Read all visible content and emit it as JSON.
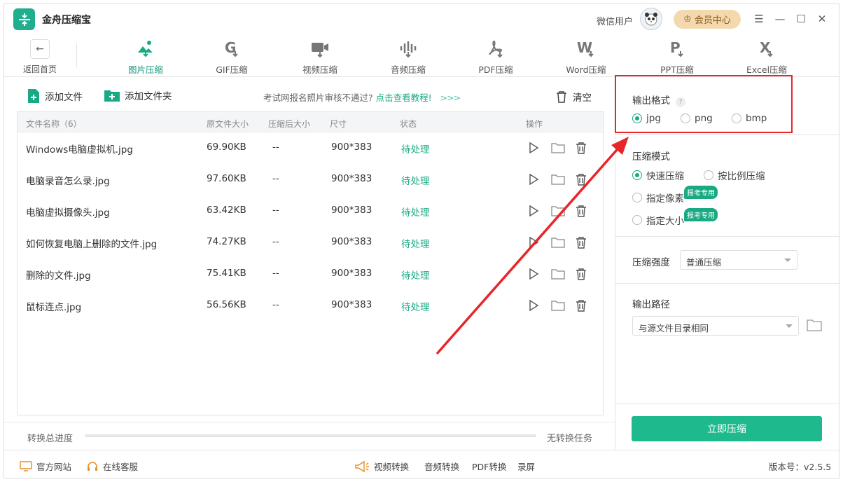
{
  "app": {
    "title": "金舟压缩宝"
  },
  "titlebar": {
    "user": "微信用户",
    "vip_label": "会员中心"
  },
  "nav": {
    "back_label": "返回首页",
    "tools": [
      {
        "label": "图片压缩",
        "icon": "image-compress-icon",
        "active": true
      },
      {
        "label": "GIF压缩",
        "icon": "gif-icon"
      },
      {
        "label": "视频压缩",
        "icon": "video-icon"
      },
      {
        "label": "音频压缩",
        "icon": "audio-icon"
      },
      {
        "label": "PDF压缩",
        "icon": "pdf-icon"
      },
      {
        "label": "Word压缩",
        "icon": "word-icon"
      },
      {
        "label": "PPT压缩",
        "icon": "ppt-icon"
      },
      {
        "label": "Excel压缩",
        "icon": "excel-icon"
      }
    ]
  },
  "actions": {
    "add_file": "添加文件",
    "add_folder": "添加文件夹",
    "hint_text": "考试网报名照片审核不通过?",
    "hint_link": "点击查看教程!",
    "hint_arrows": ">>>",
    "clear": "清空"
  },
  "table": {
    "headers": {
      "name": "文件名称（6）",
      "orig": "原文件大小",
      "comp": "压缩后大小",
      "size": "尺寸",
      "status": "状态",
      "ops": "操作"
    },
    "rows": [
      {
        "name": "Windows电脑虚拟机.jpg",
        "orig": "69.90KB",
        "comp": "--",
        "size": "900*383",
        "status": "待处理"
      },
      {
        "name": "电脑录音怎么录.jpg",
        "orig": "97.60KB",
        "comp": "--",
        "size": "900*383",
        "status": "待处理"
      },
      {
        "name": "电脑虚拟摄像头.jpg",
        "orig": "63.42KB",
        "comp": "--",
        "size": "900*383",
        "status": "待处理"
      },
      {
        "name": "如何恢复电脑上删除的文件.jpg",
        "orig": "74.27KB",
        "comp": "--",
        "size": "900*383",
        "status": "待处理"
      },
      {
        "name": "删除的文件.jpg",
        "orig": "75.41KB",
        "comp": "--",
        "size": "900*383",
        "status": "待处理"
      },
      {
        "name": "鼠标连点.jpg",
        "orig": "56.56KB",
        "comp": "--",
        "size": "900*383",
        "status": "待处理"
      }
    ]
  },
  "progress": {
    "label": "转换总进度",
    "status": "无转换任务",
    "value": 0
  },
  "settings": {
    "format": {
      "title": "输出格式",
      "help": "?",
      "options": [
        "jpg",
        "png",
        "bmp"
      ],
      "selected": "jpg"
    },
    "mode": {
      "title": "压缩模式",
      "fast": "快速压缩",
      "ratio": "按比例压缩",
      "pixel": "指定像素",
      "size": "指定大小",
      "badge": "报考专用",
      "selected": "快速压缩"
    },
    "strength": {
      "title": "压缩强度",
      "value": "普通压缩"
    },
    "path": {
      "title": "输出路径",
      "value": "与源文件目录相同"
    },
    "go": "立即压缩"
  },
  "footer": {
    "website": "官方网站",
    "support": "在线客服",
    "video_convert": "视频转换",
    "audio_convert": "音频转换",
    "pdf_convert": "PDF转换",
    "record": "录屏",
    "version": "版本号：v2.5.5"
  },
  "colors": {
    "accent": "#1aaa83",
    "annotation": "#e8262a",
    "vip_bg": "#f3d9ad"
  }
}
